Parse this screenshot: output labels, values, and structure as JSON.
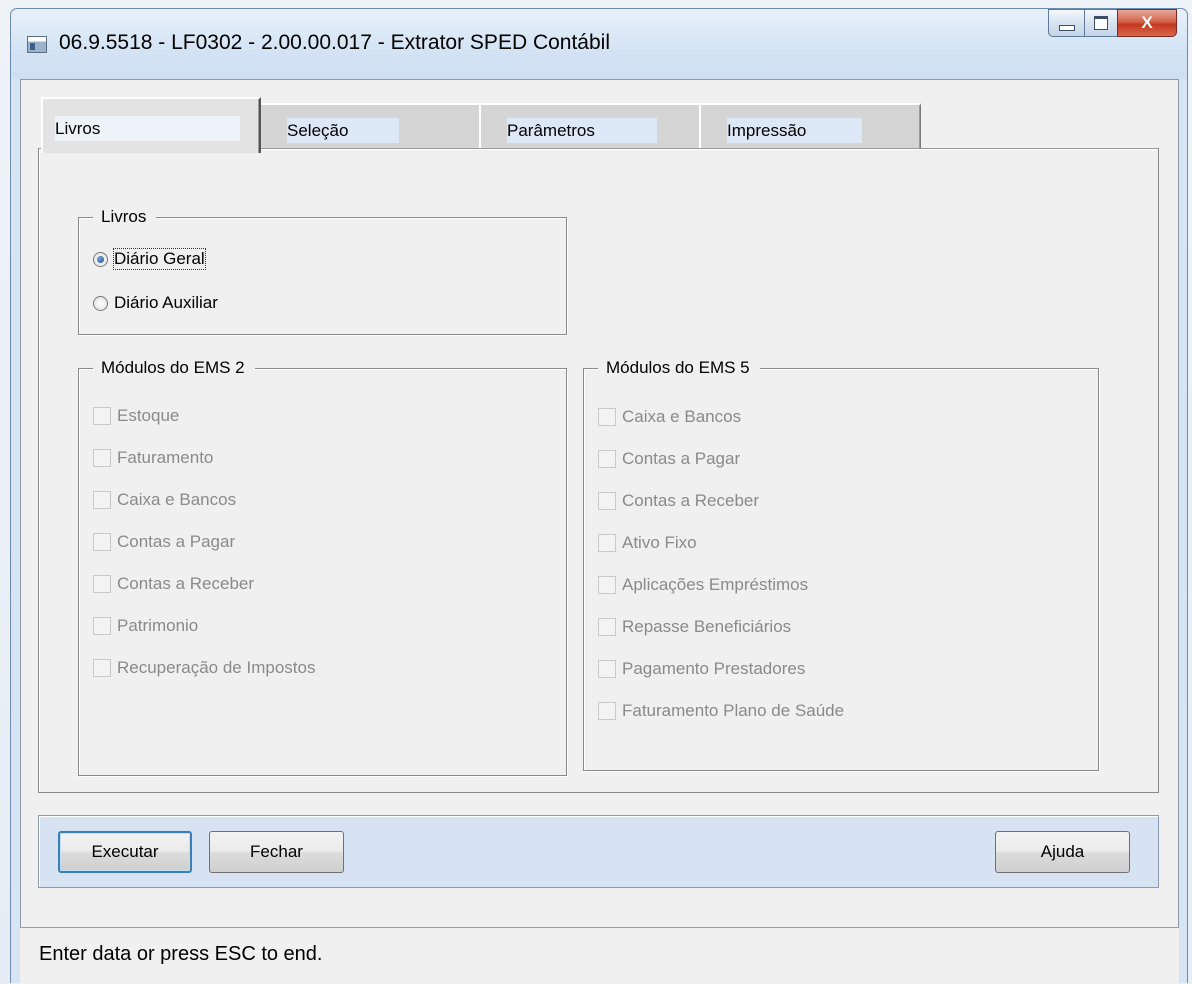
{
  "window": {
    "title": "06.9.5518 - LF0302 - 2.00.00.017 - Extrator SPED Contábil",
    "close_glyph": "X"
  },
  "tabs": [
    {
      "label": "Livros",
      "active": true
    },
    {
      "label": "Seleção",
      "active": false
    },
    {
      "label": "Parâmetros",
      "active": false
    },
    {
      "label": "Impressão",
      "active": false
    }
  ],
  "livros": {
    "title": "Livros",
    "options": [
      {
        "label": "Diário Geral",
        "checked": true
      },
      {
        "label": "Diário Auxiliar",
        "checked": false
      }
    ]
  },
  "ems2": {
    "title": "Módulos do EMS 2",
    "items": [
      "Estoque",
      "Faturamento",
      "Caixa e Bancos",
      "Contas a Pagar",
      "Contas a Receber",
      "Patrimonio",
      "Recuperação de Impostos"
    ]
  },
  "ems5": {
    "title": "Módulos do EMS 5",
    "items": [
      "Caixa e Bancos",
      "Contas a Pagar",
      "Contas a Receber",
      "Ativo Fixo",
      "Aplicações Empréstimos",
      "Repasse Beneficiários",
      "Pagamento Prestadores",
      "Faturamento Plano de Saúde"
    ]
  },
  "buttons": {
    "execute": "Executar",
    "close": "Fechar",
    "help": "Ajuda"
  },
  "status": {
    "text": "Enter data or press ESC to end."
  }
}
